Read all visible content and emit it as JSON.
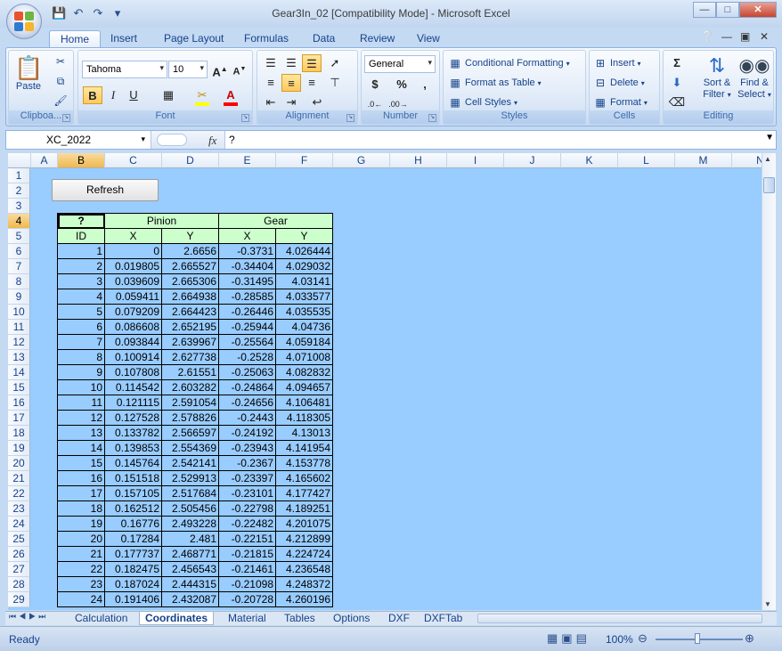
{
  "window": {
    "title": "Gear3In_02  [Compatibility Mode] - Microsoft Excel"
  },
  "tabs": [
    "Home",
    "Insert",
    "Page Layout",
    "Formulas",
    "Data",
    "Review",
    "View"
  ],
  "ribbon": {
    "clipboard": {
      "label": "Clipboa...",
      "paste": "Paste"
    },
    "font": {
      "label": "Font",
      "name": "Tahoma",
      "size": "10"
    },
    "alignment": {
      "label": "Alignment"
    },
    "number": {
      "label": "Number",
      "format": "General"
    },
    "styles": {
      "label": "Styles",
      "conditional": "Conditional Formatting",
      "format_table": "Format as Table",
      "cell_styles": "Cell Styles"
    },
    "cells": {
      "label": "Cells",
      "insert": "Insert",
      "delete": "Delete",
      "format": "Format"
    },
    "editing": {
      "label": "Editing",
      "sort1": "Sort &",
      "sort2": "Filter",
      "find1": "Find &",
      "find2": "Select"
    }
  },
  "formula_bar": {
    "name_box": "XC_2022",
    "fx": "fx",
    "content": "?"
  },
  "columns": [
    "A",
    "B",
    "C",
    "D",
    "E",
    "F",
    "G",
    "H",
    "I",
    "J",
    "K",
    "L",
    "M",
    "N"
  ],
  "rows": [
    "1",
    "2",
    "3",
    "4",
    "5",
    "6",
    "7",
    "8",
    "9",
    "10",
    "11",
    "12",
    "13",
    "14",
    "15",
    "16",
    "17",
    "18",
    "19",
    "20",
    "21",
    "22",
    "23",
    "24",
    "25",
    "26",
    "27",
    "28",
    "29"
  ],
  "sheet": {
    "refresh_button": "Refresh",
    "header_q": "?",
    "header_pinion": "Pinion",
    "header_gear": "Gear",
    "subheaders": [
      "ID",
      "X",
      "Y",
      "X",
      "Y"
    ],
    "data": [
      [
        "1",
        "0",
        "2.6656",
        "-0.3731",
        "4.026444"
      ],
      [
        "2",
        "0.019805",
        "2.665527",
        "-0.34404",
        "4.029032"
      ],
      [
        "3",
        "0.039609",
        "2.665306",
        "-0.31495",
        "4.03141"
      ],
      [
        "4",
        "0.059411",
        "2.664938",
        "-0.28585",
        "4.033577"
      ],
      [
        "5",
        "0.079209",
        "2.664423",
        "-0.26446",
        "4.035535"
      ],
      [
        "6",
        "0.086608",
        "2.652195",
        "-0.25944",
        "4.04736"
      ],
      [
        "7",
        "0.093844",
        "2.639967",
        "-0.25564",
        "4.059184"
      ],
      [
        "8",
        "0.100914",
        "2.627738",
        "-0.2528",
        "4.071008"
      ],
      [
        "9",
        "0.107808",
        "2.61551",
        "-0.25063",
        "4.082832"
      ],
      [
        "10",
        "0.114542",
        "2.603282",
        "-0.24864",
        "4.094657"
      ],
      [
        "11",
        "0.121115",
        "2.591054",
        "-0.24656",
        "4.106481"
      ],
      [
        "12",
        "0.127528",
        "2.578826",
        "-0.2443",
        "4.118305"
      ],
      [
        "13",
        "0.133782",
        "2.566597",
        "-0.24192",
        "4.13013"
      ],
      [
        "14",
        "0.139853",
        "2.554369",
        "-0.23943",
        "4.141954"
      ],
      [
        "15",
        "0.145764",
        "2.542141",
        "-0.2367",
        "4.153778"
      ],
      [
        "16",
        "0.151518",
        "2.529913",
        "-0.23397",
        "4.165602"
      ],
      [
        "17",
        "0.157105",
        "2.517684",
        "-0.23101",
        "4.177427"
      ],
      [
        "18",
        "0.162512",
        "2.505456",
        "-0.22798",
        "4.189251"
      ],
      [
        "19",
        "0.16776",
        "2.493228",
        "-0.22482",
        "4.201075"
      ],
      [
        "20",
        "0.17284",
        "2.481",
        "-0.22151",
        "4.212899"
      ],
      [
        "21",
        "0.177737",
        "2.468771",
        "-0.21815",
        "4.224724"
      ],
      [
        "22",
        "0.182475",
        "2.456543",
        "-0.21461",
        "4.236548"
      ],
      [
        "23",
        "0.187024",
        "2.444315",
        "-0.21098",
        "4.248372"
      ],
      [
        "24",
        "0.191406",
        "2.432087",
        "-0.20728",
        "4.260196"
      ]
    ]
  },
  "sheet_tabs": [
    "Calculation",
    "Coordinates",
    "Material",
    "Tables",
    "Options",
    "DXF",
    "DXFTab"
  ],
  "status": {
    "ready": "Ready",
    "zoom": "100%"
  }
}
